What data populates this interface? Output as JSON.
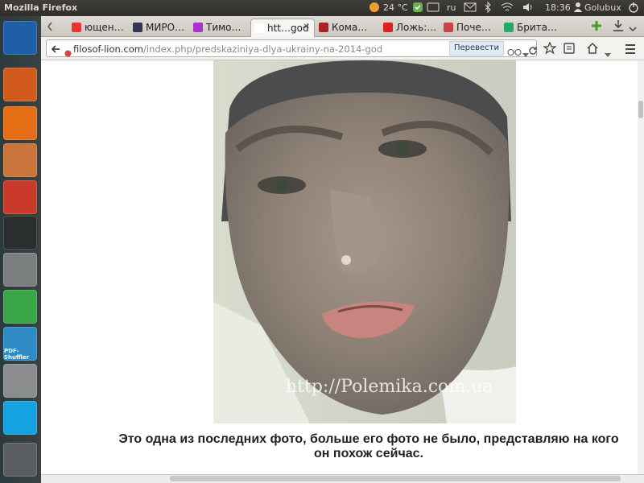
{
  "topbar": {
    "app_title": "Mozilla Firefox",
    "weather": "24 °C",
    "keyboard_layout": "ru",
    "time": "18:36",
    "user": "Golubux"
  },
  "launcher": {
    "items": [
      {
        "icon": "writer-document-icon",
        "color": "#1f5fa8"
      },
      {
        "icon": "software-center-bag-icon",
        "color": "#d35a1e"
      },
      {
        "icon": "firefox-icon",
        "color": "#e36e14"
      },
      {
        "icon": "image-viewer-icon",
        "color": "#c8743a"
      },
      {
        "icon": "pie-chart-app-icon",
        "color": "#c93a2b"
      },
      {
        "icon": "system-monitor-icon",
        "color": "#2b2e2f"
      },
      {
        "icon": "camera-icon",
        "color": "#7c7f80"
      },
      {
        "icon": "recycle-icon",
        "color": "#3aa647"
      },
      {
        "icon": "pdf-shuffler-icon",
        "color": "#2e8bc4",
        "label": "PDF-Shuffler"
      },
      {
        "icon": "calculator-icon",
        "color": "#8a8c8d"
      },
      {
        "icon": "skype-icon",
        "color": "#14a3e0"
      },
      {
        "icon": "trash-icon",
        "color": "#5a5e60"
      }
    ]
  },
  "tabs": [
    {
      "label": "ющен…",
      "favicon_color": "#e33"
    },
    {
      "label": "МИРО…",
      "favicon_color": "#335"
    },
    {
      "label": "Тимо…",
      "favicon_color": "#a3c"
    },
    {
      "label": "htt…god",
      "favicon_color": "#fff",
      "active": true
    },
    {
      "label": "Кома…",
      "favicon_color": "#a22"
    },
    {
      "label": "Ложь:…",
      "favicon_color": "#d22"
    },
    {
      "label": "Поче…",
      "favicon_color": "#c44"
    },
    {
      "label": "Брита…",
      "favicon_color": "#2a6"
    }
  ],
  "navbar": {
    "url_domain": "filosof-lion.com",
    "url_path": "/index.php/predskaziniya-dlya-ukrainy-na-2014-god",
    "translate_label": "Перевести"
  },
  "content": {
    "watermark": "http://Polemika.com.ua",
    "caption": "Это одна из последних фото, больше его фото не было, представляю на кого он похож сейчас."
  }
}
